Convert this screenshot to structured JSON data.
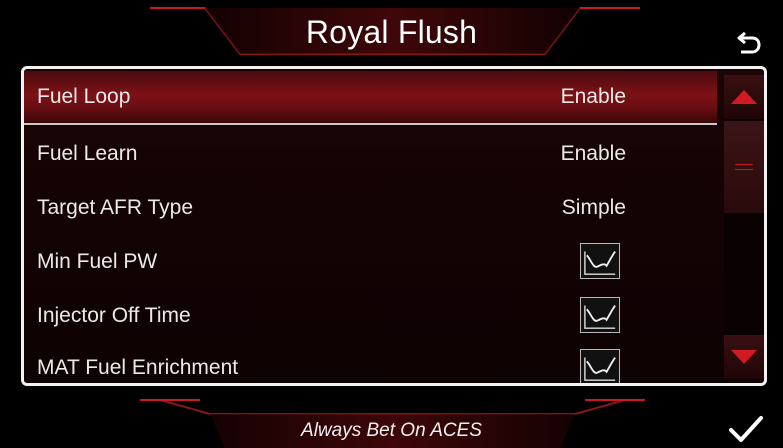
{
  "header": {
    "title": "Royal Flush",
    "back_icon": "back-arrow-icon"
  },
  "list": {
    "rows": [
      {
        "label": "Fuel Loop",
        "value": "Enable",
        "selected": true
      },
      {
        "label": "Fuel Learn",
        "value": "Enable"
      },
      {
        "label": "Target AFR Type",
        "value": "Simple"
      },
      {
        "label": "Min Fuel PW",
        "value_icon": "graph-icon"
      },
      {
        "label": "Injector Off Time",
        "value_icon": "graph-icon"
      },
      {
        "label": "MAT Fuel Enrichment",
        "value_icon": "graph-icon"
      }
    ]
  },
  "scrollbar": {
    "up_icon": "triangle-up-icon",
    "down_icon": "triangle-down-icon"
  },
  "footer": {
    "tagline": "Always Bet On ACES",
    "confirm_icon": "checkmark-icon"
  },
  "colors": {
    "accent": "#c51a20",
    "selected_row": "#7c1116",
    "border": "#f2f2f2"
  }
}
